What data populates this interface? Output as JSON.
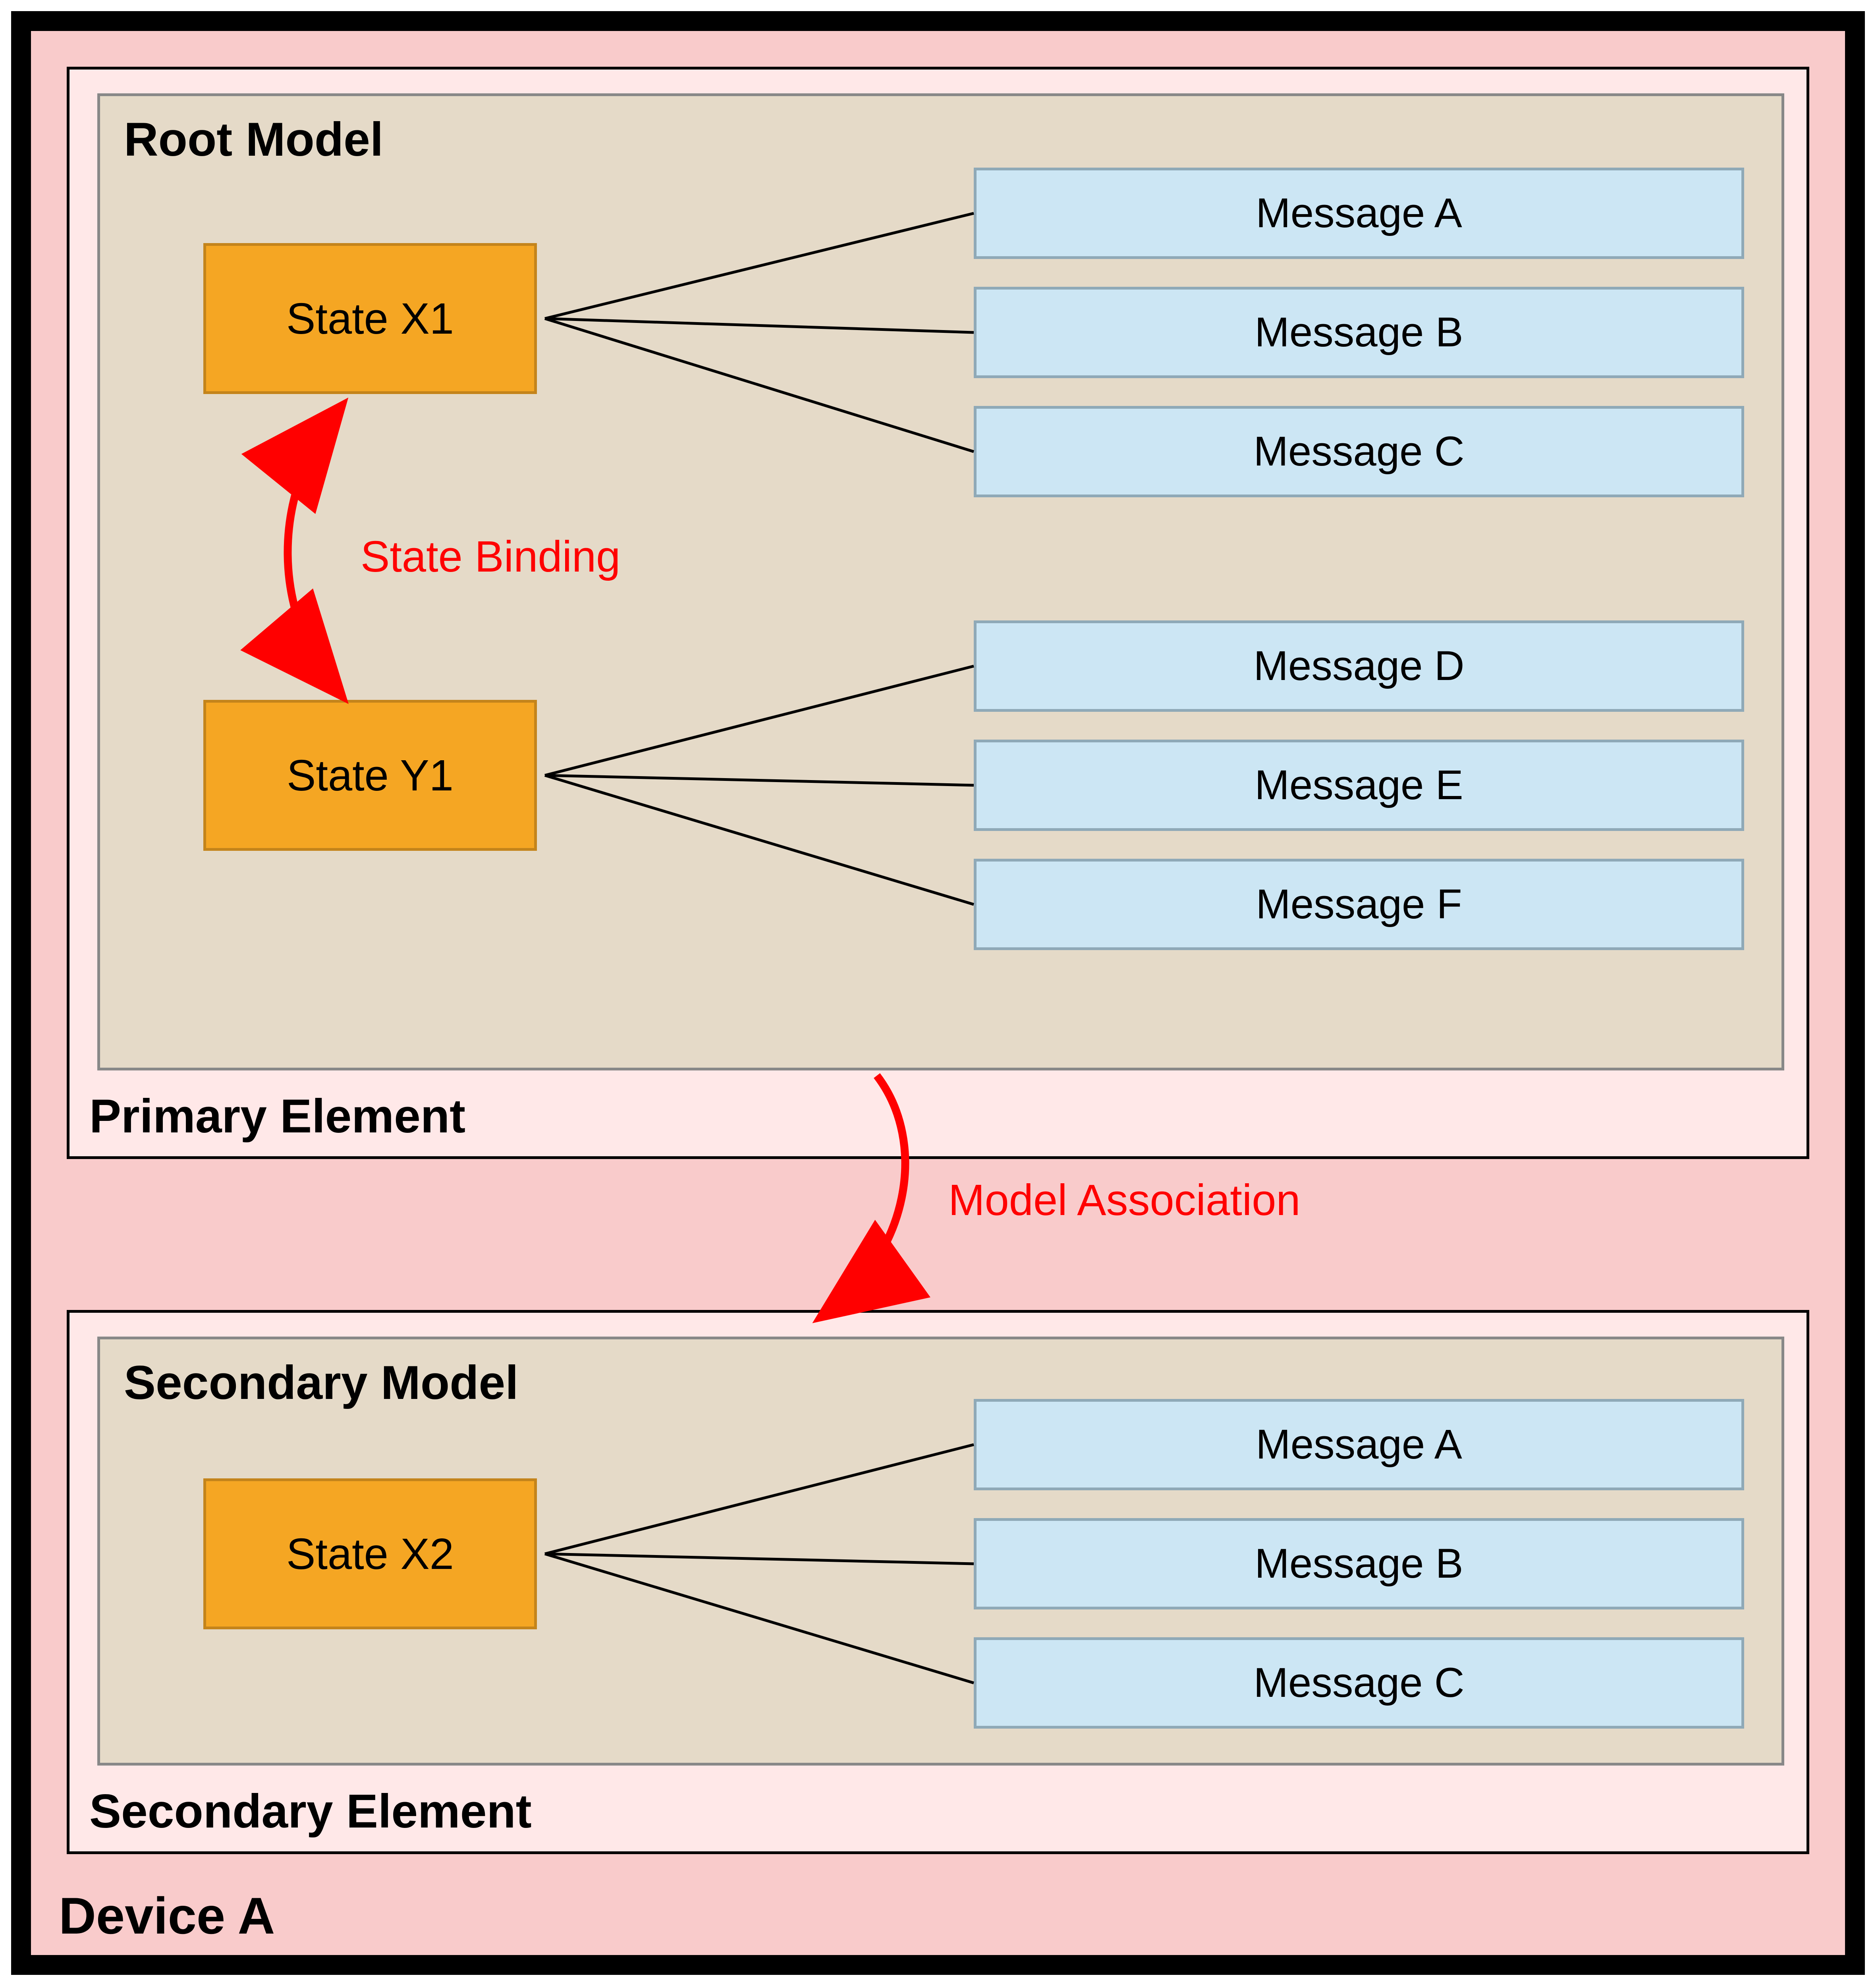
{
  "device": {
    "label": "Device A"
  },
  "primary": {
    "element_label": "Primary Element",
    "model_label": "Root Model",
    "states": [
      {
        "label": "State X1"
      },
      {
        "label": "State Y1"
      }
    ],
    "messages_x1": [
      {
        "label": "Message A"
      },
      {
        "label": "Message B"
      },
      {
        "label": "Message C"
      }
    ],
    "messages_y1": [
      {
        "label": "Message D"
      },
      {
        "label": "Message E"
      },
      {
        "label": "Message F"
      }
    ]
  },
  "secondary": {
    "element_label": "Secondary Element",
    "model_label": "Secondary Model",
    "state": {
      "label": "State X2"
    },
    "messages": [
      {
        "label": "Message A"
      },
      {
        "label": "Message B"
      },
      {
        "label": "Message C"
      }
    ]
  },
  "relations": {
    "state_binding": "State Binding",
    "model_association": "Model Association"
  }
}
